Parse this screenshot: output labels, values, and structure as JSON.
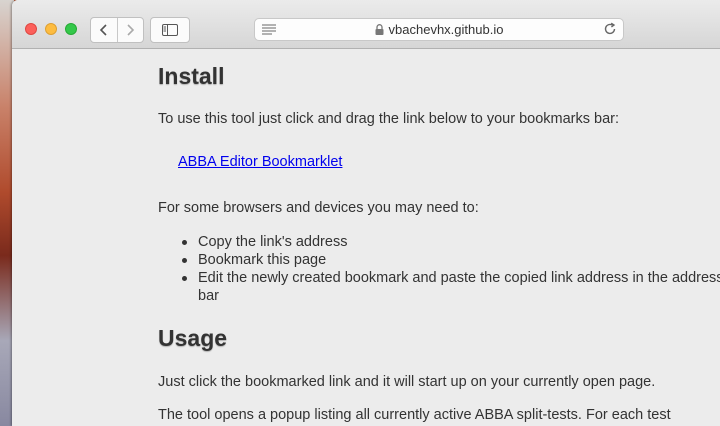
{
  "browser": {
    "url": "vbachevhx.github.io",
    "icons": {
      "back": "chevron-left-icon",
      "forward": "chevron-right-icon",
      "sidebar": "sidebar-icon",
      "reader": "reader-icon",
      "lock": "lock-icon",
      "reload": "reload-icon"
    }
  },
  "page": {
    "install_heading": "Install",
    "install_intro": "To use this tool just click and drag the link below to your bookmarks bar:",
    "bookmarklet_link": "ABBA Editor Bookmarklet",
    "browsers_note": "For some browsers and devices you may need to:",
    "steps": [
      "Copy the link's address",
      "Bookmark this page",
      "Edit the newly created bookmark and paste the copied link address in the address bar"
    ],
    "usage_heading": "Usage",
    "usage_p1": "Just click the bookmarked link and it will start up on your currently open page.",
    "usage_p2": "The tool opens a popup listing all currently active ABBA split-tests. For each test"
  },
  "colors": {
    "link": "#0000ee",
    "text": "#333333",
    "page_bg": "#ececec"
  }
}
